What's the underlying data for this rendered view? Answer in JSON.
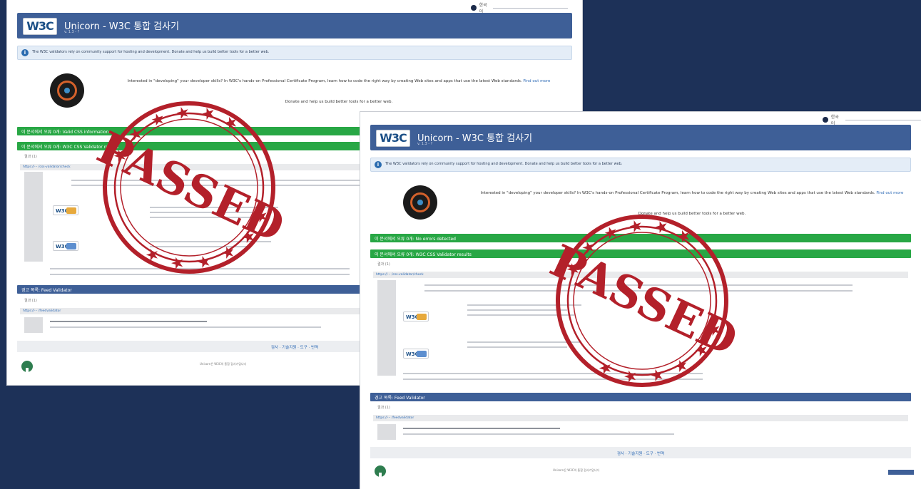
{
  "screens": [
    {
      "lang_label": "한국어",
      "header_title": "Unicorn - W3C 통합 검사기",
      "header_subtitle": "v. 1.3 - ?",
      "logo": "W3C",
      "info_text": "The W3C validators rely on community support for hosting and development. Donate and help us build better tools for a better web.",
      "promo_text": "Interested in \"developing\" your developer skills? In W3C's hands-on Professional Certificate Program, learn how to code the right way by creating Web sites and apps that use the latest Web standards.",
      "promo_link": "Find out more",
      "donate_text": "Donate and help us build better tools for a better web.",
      "bar_green_1": "이 문서에서 오류 0개: Valid CSS information",
      "bar_green_2": "이 문서에서 오류 0개: W3C CSS Validator results",
      "bar_blue": "경고 목록: Feed Validator",
      "footer_links": "검사 · 기술지원 · 도구 · 번역",
      "footer_note": "Unicorn은 W3C의 통합 검사기입니다"
    },
    {
      "lang_label": "한국어",
      "header_title": "Unicorn - W3C 통합 검사기",
      "header_subtitle": "v. 1.3 - ?",
      "logo": "W3C",
      "info_text": "The W3C validators rely on community support for hosting and development. Donate and help us build better tools for a better web.",
      "promo_text": "Interested in \"developing\" your developer skills? In W3C's hands-on Professional Certificate Program, learn how to code the right way by creating Web sites and apps that use the latest Web standards.",
      "promo_link": "Find out more",
      "donate_text": "Donate and help us build better tools for a better web.",
      "bar_green_1": "이 문서에서 오류 0개: No errors detected",
      "bar_green_2": "이 문서에서 오류 0개: W3C CSS Validator results",
      "bar_blue": "경고 목록: Feed Validator",
      "footer_links": "검사 · 기술지원 · 도구 · 번역",
      "footer_note": "Unicorn은 W3C의 통합 검사기입니다"
    }
  ],
  "stamp_text": "PASSED",
  "colors": {
    "stamp": "#b3202a",
    "header": "#3e5f97",
    "green": "#28a745",
    "background": "#1d3158"
  }
}
